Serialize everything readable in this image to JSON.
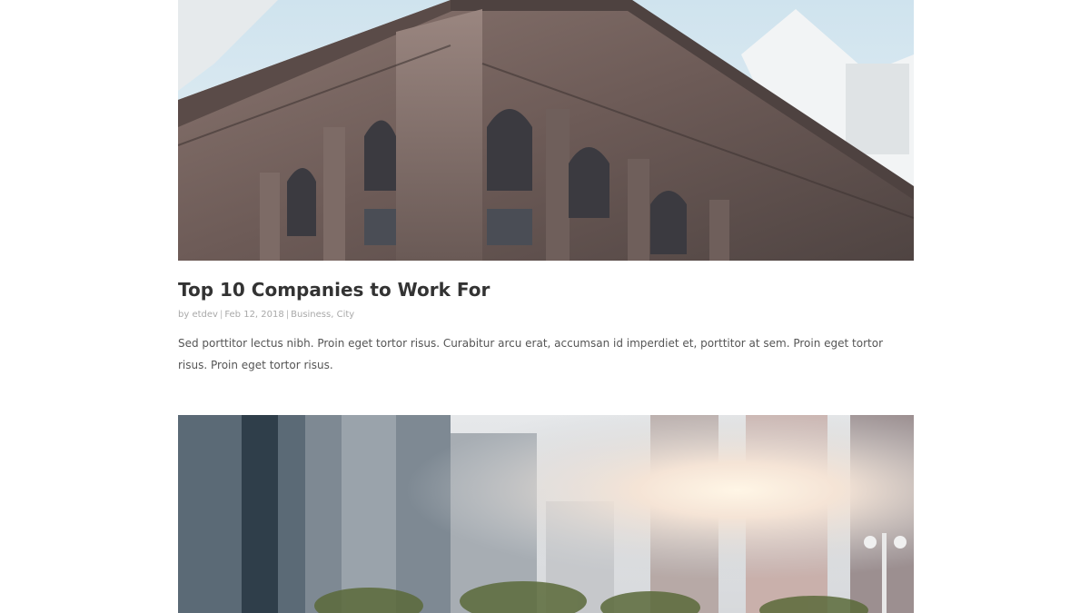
{
  "posts": [
    {
      "image_alt": "Ornate stone building facade",
      "title": "Top 10 Companies to Work For",
      "meta": {
        "by": "by",
        "author": "etdev",
        "date": "Feb 12, 2018",
        "category_1": "Business",
        "category_2": "City",
        "category_sep": ", "
      },
      "excerpt": "Sed porttitor lectus nibh. Proin eget tortor risus. Curabitur arcu erat, accumsan id imperdiet et, porttitor at sem. Proin eget tortor risus. Proin eget tortor risus."
    },
    {
      "image_alt": "Blurred city skyline with sun flare"
    }
  ],
  "colors": {
    "title": "#333333",
    "meta": "#a9a9a9",
    "excerpt": "#555555",
    "background": "#ffffff"
  }
}
